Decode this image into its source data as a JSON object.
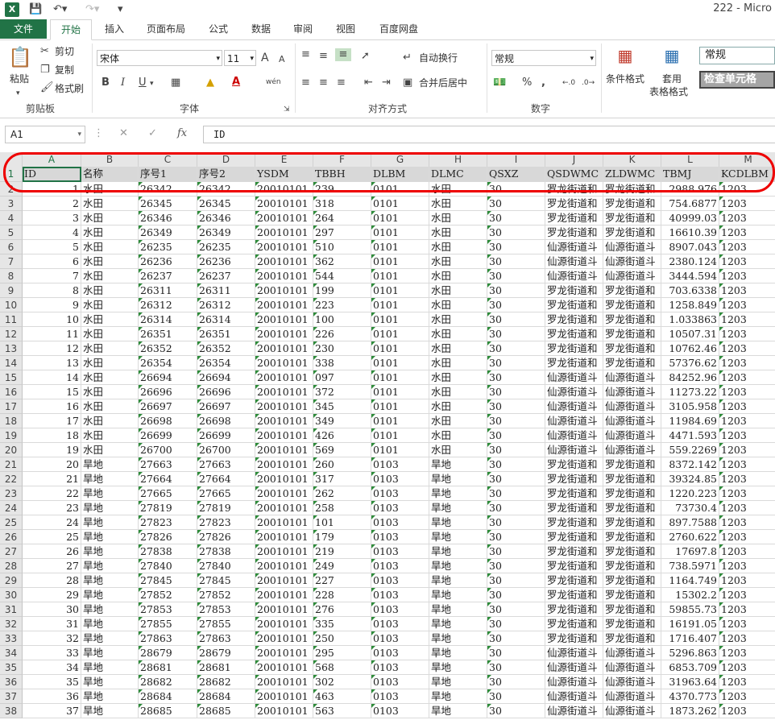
{
  "titlebar": {
    "app_badge": "X",
    "title": "222 - Micro"
  },
  "tabs": [
    "文件",
    "开始",
    "插入",
    "页面布局",
    "公式",
    "数据",
    "审阅",
    "视图",
    "百度网盘"
  ],
  "ribbon": {
    "clipboard": {
      "paste": "粘贴",
      "cut": "剪切",
      "copy": "复制",
      "format_painter": "格式刷",
      "label": "剪贴板"
    },
    "font": {
      "name": "宋体",
      "size": "11",
      "grow": "A",
      "shrink": "A",
      "bold": "B",
      "italic": "I",
      "underline": "U",
      "phonetic": "wén",
      "label": "字体"
    },
    "alignment": {
      "wrap": "自动换行",
      "merge": "合并后居中",
      "label": "对齐方式"
    },
    "number": {
      "format": "常规",
      "percent": "%",
      "comma": ",",
      "label": "数字"
    },
    "styles": {
      "conditional": "条件格式",
      "table_line1": "套用",
      "table_line2": "表格格式",
      "normal": "常规",
      "check_cell": "检查单元格"
    }
  },
  "formula_bar": {
    "name_box": "A1",
    "fx": "fx",
    "value": "ID"
  },
  "columns": [
    "A",
    "B",
    "C",
    "D",
    "E",
    "F",
    "G",
    "H",
    "I",
    "J",
    "K",
    "L",
    "M"
  ],
  "header_row": [
    "ID",
    "名称",
    "序号1",
    "序号2",
    "YSDM",
    "TBBH",
    "DLBM",
    "DLMC",
    "QSXZ",
    "QSDWMC",
    "ZLDWMC",
    "TBMJ",
    "KCDLBM"
  ],
  "rows": [
    [
      "2",
      "1",
      "水田",
      "26342",
      "26342",
      "20010101",
      "239",
      "0101",
      "水田",
      "30",
      "罗龙街道和",
      "罗龙街道和",
      "2988.976",
      "1203"
    ],
    [
      "3",
      "2",
      "水田",
      "26345",
      "26345",
      "20010101",
      "318",
      "0101",
      "水田",
      "30",
      "罗龙街道和",
      "罗龙街道和",
      "754.6877",
      "1203"
    ],
    [
      "4",
      "3",
      "水田",
      "26346",
      "26346",
      "20010101",
      "264",
      "0101",
      "水田",
      "30",
      "罗龙街道和",
      "罗龙街道和",
      "40999.03",
      "1203"
    ],
    [
      "5",
      "4",
      "水田",
      "26349",
      "26349",
      "20010101",
      "297",
      "0101",
      "水田",
      "30",
      "罗龙街道和",
      "罗龙街道和",
      "16610.39",
      "1203"
    ],
    [
      "6",
      "5",
      "水田",
      "26235",
      "26235",
      "20010101",
      "510",
      "0101",
      "水田",
      "30",
      "仙源街道斗",
      "仙源街道斗",
      "8907.043",
      "1203"
    ],
    [
      "7",
      "6",
      "水田",
      "26236",
      "26236",
      "20010101",
      "362",
      "0101",
      "水田",
      "30",
      "仙源街道斗",
      "仙源街道斗",
      "2380.124",
      "1203"
    ],
    [
      "8",
      "7",
      "水田",
      "26237",
      "26237",
      "20010101",
      "544",
      "0101",
      "水田",
      "30",
      "仙源街道斗",
      "仙源街道斗",
      "3444.594",
      "1203"
    ],
    [
      "9",
      "8",
      "水田",
      "26311",
      "26311",
      "20010101",
      "199",
      "0101",
      "水田",
      "30",
      "罗龙街道和",
      "罗龙街道和",
      "703.6338",
      "1203"
    ],
    [
      "10",
      "9",
      "水田",
      "26312",
      "26312",
      "20010101",
      "223",
      "0101",
      "水田",
      "30",
      "罗龙街道和",
      "罗龙街道和",
      "1258.849",
      "1203"
    ],
    [
      "11",
      "10",
      "水田",
      "26314",
      "26314",
      "20010101",
      "100",
      "0101",
      "水田",
      "30",
      "罗龙街道和",
      "罗龙街道和",
      "1.033863",
      "1203"
    ],
    [
      "12",
      "11",
      "水田",
      "26351",
      "26351",
      "20010101",
      "226",
      "0101",
      "水田",
      "30",
      "罗龙街道和",
      "罗龙街道和",
      "10507.31",
      "1203"
    ],
    [
      "13",
      "12",
      "水田",
      "26352",
      "26352",
      "20010101",
      "230",
      "0101",
      "水田",
      "30",
      "罗龙街道和",
      "罗龙街道和",
      "10762.46",
      "1203"
    ],
    [
      "14",
      "13",
      "水田",
      "26354",
      "26354",
      "20010101",
      "338",
      "0101",
      "水田",
      "30",
      "罗龙街道和",
      "罗龙街道和",
      "57376.62",
      "1203"
    ],
    [
      "15",
      "14",
      "水田",
      "26694",
      "26694",
      "20010101",
      "097",
      "0101",
      "水田",
      "30",
      "仙源街道斗",
      "仙源街道斗",
      "84252.96",
      "1203"
    ],
    [
      "16",
      "15",
      "水田",
      "26696",
      "26696",
      "20010101",
      "372",
      "0101",
      "水田",
      "30",
      "仙源街道斗",
      "仙源街道斗",
      "11273.22",
      "1203"
    ],
    [
      "17",
      "16",
      "水田",
      "26697",
      "26697",
      "20010101",
      "345",
      "0101",
      "水田",
      "30",
      "仙源街道斗",
      "仙源街道斗",
      "3105.958",
      "1203"
    ],
    [
      "18",
      "17",
      "水田",
      "26698",
      "26698",
      "20010101",
      "349",
      "0101",
      "水田",
      "30",
      "仙源街道斗",
      "仙源街道斗",
      "11984.69",
      "1203"
    ],
    [
      "19",
      "18",
      "水田",
      "26699",
      "26699",
      "20010101",
      "426",
      "0101",
      "水田",
      "30",
      "仙源街道斗",
      "仙源街道斗",
      "4471.593",
      "1203"
    ],
    [
      "20",
      "19",
      "水田",
      "26700",
      "26700",
      "20010101",
      "569",
      "0101",
      "水田",
      "30",
      "仙源街道斗",
      "仙源街道斗",
      "559.2269",
      "1203"
    ],
    [
      "21",
      "20",
      "旱地",
      "27663",
      "27663",
      "20010101",
      "260",
      "0103",
      "旱地",
      "30",
      "罗龙街道和",
      "罗龙街道和",
      "8372.142",
      "1203"
    ],
    [
      "22",
      "21",
      "旱地",
      "27664",
      "27664",
      "20010101",
      "317",
      "0103",
      "旱地",
      "30",
      "罗龙街道和",
      "罗龙街道和",
      "39324.85",
      "1203"
    ],
    [
      "23",
      "22",
      "旱地",
      "27665",
      "27665",
      "20010101",
      "262",
      "0103",
      "旱地",
      "30",
      "罗龙街道和",
      "罗龙街道和",
      "1220.223",
      "1203"
    ],
    [
      "24",
      "23",
      "旱地",
      "27819",
      "27819",
      "20010101",
      "258",
      "0103",
      "旱地",
      "30",
      "罗龙街道和",
      "罗龙街道和",
      "73730.4",
      "1203"
    ],
    [
      "25",
      "24",
      "旱地",
      "27823",
      "27823",
      "20010101",
      "101",
      "0103",
      "旱地",
      "30",
      "罗龙街道和",
      "罗龙街道和",
      "897.7588",
      "1203"
    ],
    [
      "26",
      "25",
      "旱地",
      "27826",
      "27826",
      "20010101",
      "179",
      "0103",
      "旱地",
      "30",
      "罗龙街道和",
      "罗龙街道和",
      "2760.622",
      "1203"
    ],
    [
      "27",
      "26",
      "旱地",
      "27838",
      "27838",
      "20010101",
      "219",
      "0103",
      "旱地",
      "30",
      "罗龙街道和",
      "罗龙街道和",
      "17697.8",
      "1203"
    ],
    [
      "28",
      "27",
      "旱地",
      "27840",
      "27840",
      "20010101",
      "249",
      "0103",
      "旱地",
      "30",
      "罗龙街道和",
      "罗龙街道和",
      "738.5971",
      "1203"
    ],
    [
      "29",
      "28",
      "旱地",
      "27845",
      "27845",
      "20010101",
      "227",
      "0103",
      "旱地",
      "30",
      "罗龙街道和",
      "罗龙街道和",
      "1164.749",
      "1203"
    ],
    [
      "30",
      "29",
      "旱地",
      "27852",
      "27852",
      "20010101",
      "228",
      "0103",
      "旱地",
      "30",
      "罗龙街道和",
      "罗龙街道和",
      "15302.2",
      "1203"
    ],
    [
      "31",
      "30",
      "旱地",
      "27853",
      "27853",
      "20010101",
      "276",
      "0103",
      "旱地",
      "30",
      "罗龙街道和",
      "罗龙街道和",
      "59855.73",
      "1203"
    ],
    [
      "32",
      "31",
      "旱地",
      "27855",
      "27855",
      "20010101",
      "335",
      "0103",
      "旱地",
      "30",
      "罗龙街道和",
      "罗龙街道和",
      "16191.05",
      "1203"
    ],
    [
      "33",
      "32",
      "旱地",
      "27863",
      "27863",
      "20010101",
      "250",
      "0103",
      "旱地",
      "30",
      "罗龙街道和",
      "罗龙街道和",
      "1716.407",
      "1203"
    ],
    [
      "34",
      "33",
      "旱地",
      "28679",
      "28679",
      "20010101",
      "295",
      "0103",
      "旱地",
      "30",
      "仙源街道斗",
      "仙源街道斗",
      "5296.863",
      "1203"
    ],
    [
      "35",
      "34",
      "旱地",
      "28681",
      "28681",
      "20010101",
      "568",
      "0103",
      "旱地",
      "30",
      "仙源街道斗",
      "仙源街道斗",
      "6853.709",
      "1203"
    ],
    [
      "36",
      "35",
      "旱地",
      "28682",
      "28682",
      "20010101",
      "302",
      "0103",
      "旱地",
      "30",
      "仙源街道斗",
      "仙源街道斗",
      "31963.64",
      "1203"
    ],
    [
      "37",
      "36",
      "旱地",
      "28684",
      "28684",
      "20010101",
      "463",
      "0103",
      "旱地",
      "30",
      "仙源街道斗",
      "仙源街道斗",
      "4370.773",
      "1203"
    ],
    [
      "38",
      "37",
      "旱地",
      "28685",
      "28685",
      "20010101",
      "563",
      "0103",
      "旱地",
      "30",
      "仙源街道斗",
      "仙源街道斗",
      "1873.262",
      "1203"
    ]
  ]
}
